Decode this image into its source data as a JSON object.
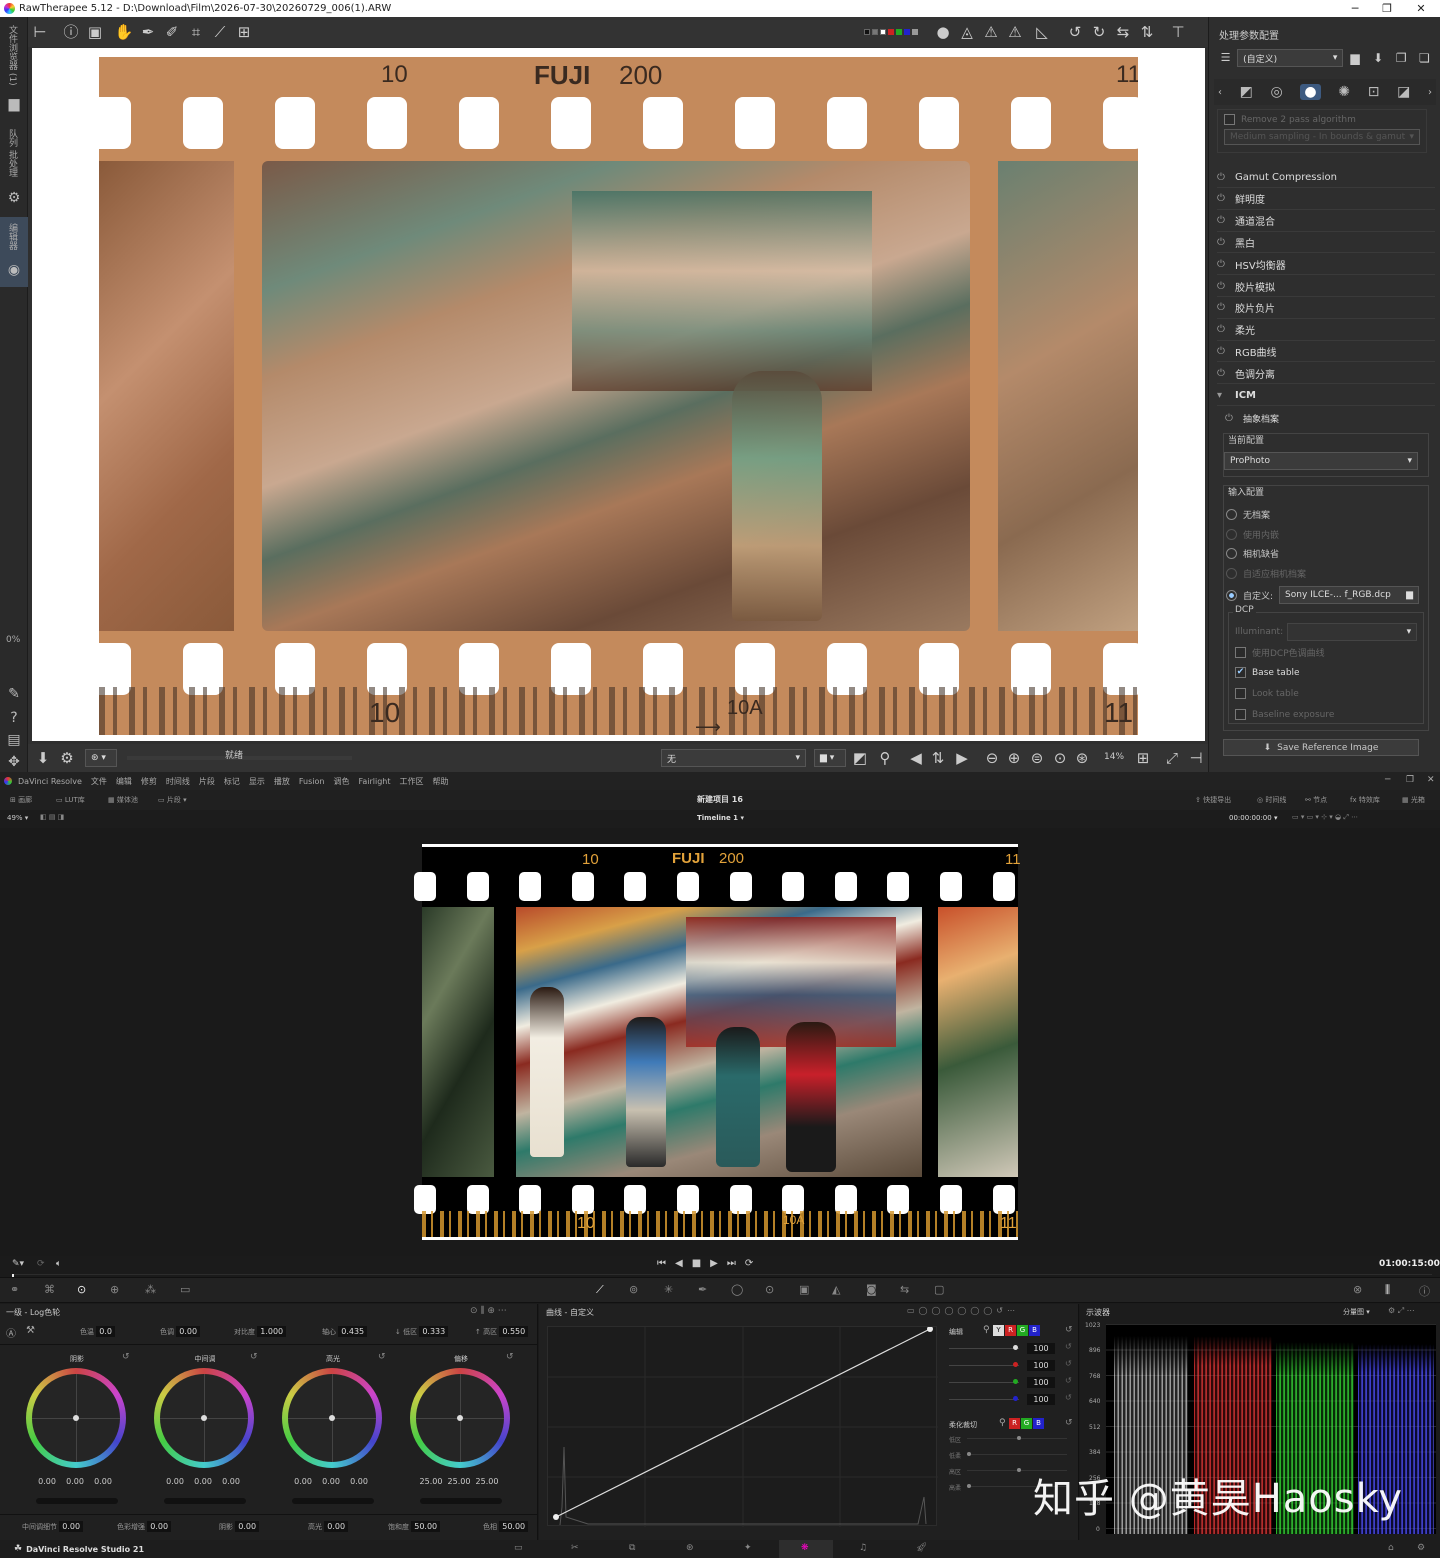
{
  "rawtherapee": {
    "title": "RawTherapee 5.12 - D:\\Download\\Film\\2026-07-30\\20260729_006(1).ARW",
    "left_tabs": [
      "文件浏览器 (1)",
      "队列 批处理",
      "编辑器"
    ],
    "left_percent": "0%",
    "film_text": {
      "top_num_left": "10",
      "brand": "FUJI",
      "iso": "200",
      "top_num_right": "11",
      "bottom_num_left": "10",
      "bottom_frame": "10A",
      "bottom_num_right": "11"
    },
    "status": "就绪",
    "bottom_dropdown": "无",
    "zoom": "14%",
    "right_panel": {
      "header": "处理参数配置",
      "profile": "(自定义)",
      "faded_option_1": "Remove 2 pass algorithm",
      "faded_option_2": "Medium sampling - In bounds & gamut",
      "sections": [
        "Gamut Compression",
        "鲜明度",
        "通道混合",
        "黑白",
        "HSV均衡器",
        "胶片模拟",
        "胶片负片",
        "柔光",
        "RGB曲线",
        "色调分离"
      ],
      "icm_header": "ICM",
      "abstract_profile": "抽象档案",
      "current_profile_label": "当前配置",
      "current_profile": "ProPhoto",
      "input_profile_label": "输入配置",
      "radio_options": [
        "无档案",
        "使用内嵌",
        "相机缺省",
        "自适应相机档案"
      ],
      "custom_label": "自定义:",
      "custom_value": "Sony ILCE-... f_RGB.dcp",
      "dcp_label": "DCP",
      "illuminant_label": "Illuminant:",
      "checkboxes": [
        {
          "label": "使用DCP色调曲线",
          "checked": false,
          "enabled": false
        },
        {
          "label": "Base table",
          "checked": true,
          "enabled": true
        },
        {
          "label": "Look table",
          "checked": false,
          "enabled": false
        },
        {
          "label": "Baseline exposure",
          "checked": false,
          "enabled": false
        }
      ],
      "save_reference": "Save Reference Image"
    }
  },
  "davinci": {
    "menu": [
      "DaVinci Resolve",
      "文件",
      "编辑",
      "修剪",
      "时间线",
      "片段",
      "标记",
      "显示",
      "播放",
      "Fusion",
      "调色",
      "Fairlight",
      "工作区",
      "帮助"
    ],
    "toolbar_left": [
      "画廊",
      "LUT库",
      "媒体池",
      "片段"
    ],
    "project_title": "新建项目 16",
    "toolbar_right": [
      "快捷导出",
      "时间线",
      "节点",
      "特效库",
      "光箱"
    ],
    "zoom": "49%",
    "timeline": "Timeline 1",
    "timecode": "00:00:00:00",
    "duration": "01:00:15:00",
    "film_text": {
      "top_num_left": "10",
      "brand": "FUJI",
      "iso": "200",
      "top_num_right": "11",
      "bottom_num_left": "10",
      "bottom_frame": "10A",
      "bottom_num_right": "11"
    },
    "primaries": {
      "title": "一级 - Log色轮",
      "params": [
        {
          "label": "色温",
          "value": "0.0"
        },
        {
          "label": "色调",
          "value": "0.00"
        },
        {
          "label": "对比度",
          "value": "1.000"
        },
        {
          "label": "轴心",
          "value": "0.435"
        },
        {
          "label": "↓ 低区",
          "value": "0.333"
        },
        {
          "label": "↑ 高区",
          "value": "0.550"
        }
      ],
      "wheels": [
        {
          "name": "阴影",
          "values": [
            "0.00",
            "0.00",
            "0.00"
          ]
        },
        {
          "name": "中间调",
          "values": [
            "0.00",
            "0.00",
            "0.00"
          ]
        },
        {
          "name": "高光",
          "values": [
            "0.00",
            "0.00",
            "0.00"
          ]
        },
        {
          "name": "偏移",
          "values": [
            "25.00",
            "25.00",
            "25.00"
          ]
        }
      ],
      "bottom_params": [
        {
          "label": "中间调细节",
          "value": "0.00"
        },
        {
          "label": "色彩增强",
          "value": "0.00"
        },
        {
          "label": "阴影",
          "value": "0.00"
        },
        {
          "label": "高光",
          "value": "0.00"
        },
        {
          "label": "饱和度",
          "value": "50.00"
        },
        {
          "label": "色相",
          "value": "50.00"
        }
      ]
    },
    "curves": {
      "title": "曲线 - 自定义",
      "edit_label": "编辑",
      "channels": [
        "Y",
        "R",
        "G",
        "B"
      ],
      "intensities": [
        "100",
        "100",
        "100",
        "100"
      ],
      "soft_clip_label": "柔化裁切",
      "soft_clip_rows": [
        "低区",
        "低柔",
        "高区",
        "高柔"
      ]
    },
    "scope": {
      "title": "示波器",
      "mode": "分量图",
      "ticks": [
        "1023",
        "896",
        "768",
        "640",
        "512",
        "384",
        "256",
        "128",
        "0"
      ]
    },
    "status_label": "DaVinci Resolve Studio 21",
    "watermark": "知乎 @黄昊Haosky"
  }
}
